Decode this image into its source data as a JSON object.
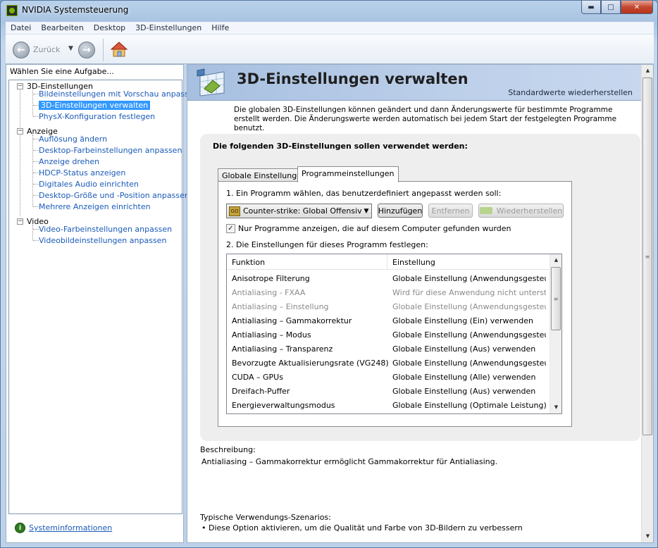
{
  "window": {
    "title": "NVIDIA Systemsteuerung",
    "buttons": {
      "minimize": "▬",
      "maximize": "□",
      "close": "✕"
    }
  },
  "menu": [
    "Datei",
    "Bearbeiten",
    "Desktop",
    "3D-Einstellungen",
    "Hilfe"
  ],
  "toolbar": {
    "back_label": "Zurück"
  },
  "left": {
    "header": "Wählen Sie eine Aufgabe...",
    "groups": [
      {
        "label": "3D-Einstellungen",
        "items": [
          "Bildeinstellungen mit Vorschau anpassen",
          "3D-Einstellungen verwalten",
          "PhysX-Konfiguration festlegen"
        ]
      },
      {
        "label": "Anzeige",
        "items": [
          "Auflösung ändern",
          "Desktop-Farbeinstellungen anpassen",
          "Anzeige drehen",
          "HDCP-Status anzeigen",
          "Digitales Audio einrichten",
          "Desktop-Größe und -Position anpassen",
          "Mehrere Anzeigen einrichten"
        ]
      },
      {
        "label": "Video",
        "items": [
          "Video-Farbeinstellungen anpassen",
          "Videobildeinstellungen anpassen"
        ]
      }
    ],
    "selected": "3D-Einstellungen verwalten",
    "sysinfo": "Systeminformationen"
  },
  "main": {
    "title": "3D-Einstellungen verwalten",
    "restore_defaults": "Standardwerte wiederherstellen",
    "intro": "Die globalen 3D-Einstellungen können geändert und dann Änderungswerte für bestimmte Programme erstellt werden. Die Änderungswerte werden automatisch bei jedem Start der festgelegten Programme benutzt.",
    "panel_heading": "Die folgenden 3D-Einstellungen sollen verwendet werden:",
    "tabs": [
      "Globale Einstellungen",
      "Programmeinstellungen"
    ],
    "active_tab": "Programmeinstellungen",
    "step1": "1. Ein Programm wählen, das benutzerdefiniert angepasst werden soll:",
    "program_selected": "Counter-strike: Global Offensiv...",
    "buttons": {
      "add": "Hinzufügen",
      "remove": "Entfernen",
      "restore": "Wiederherstellen"
    },
    "checkbox_label": "Nur Programme anzeigen, die auf diesem Computer gefunden wurden",
    "checkbox_checked": true,
    "step2": "2. Die Einstellungen für dieses Programm festlegen:",
    "grid_headers": [
      "Funktion",
      "Einstellung"
    ],
    "grid_rows": [
      {
        "function": "Anisotrope Filterung",
        "setting": "Globale Einstellung (Anwendungsgesteuer...",
        "disabled": false
      },
      {
        "function": "Antialiasing - FXAA",
        "setting": "Wird für diese Anwendung nicht unterstützt",
        "disabled": true
      },
      {
        "function": "Antialiasing – Einstellung",
        "setting": "Globale Einstellung (Anwendungsgesteuer...",
        "disabled": true
      },
      {
        "function": "Antialiasing – Gammakorrektur",
        "setting": "Globale Einstellung (Ein) verwenden",
        "disabled": false
      },
      {
        "function": "Antialiasing – Modus",
        "setting": "Globale Einstellung (Anwendungsgesteuer...",
        "disabled": false
      },
      {
        "function": "Antialiasing – Transparenz",
        "setting": "Globale Einstellung (Aus) verwenden",
        "disabled": false
      },
      {
        "function": "Bevorzugte Aktualisierungsrate (VG248)",
        "setting": "Globale Einstellung (Anwendungsgesteuer...",
        "disabled": false
      },
      {
        "function": "CUDA – GPUs",
        "setting": "Globale Einstellung (Alle) verwenden",
        "disabled": false
      },
      {
        "function": "Dreifach-Puffer",
        "setting": "Globale Einstellung (Aus) verwenden",
        "disabled": false
      },
      {
        "function": "Energieverwaltungsmodus",
        "setting": "Globale Einstellung (Optimale Leistung) ver...",
        "disabled": false
      }
    ],
    "description_label": "Beschreibung:",
    "description_text": "Antialiasing – Gammakorrektur ermöglicht Gammakorrektur für Antialiasing.",
    "scenarios_label": "Typische Verwendungs-Szenarios:",
    "scenarios_text": "• Diese Option aktivieren, um die Qualität und Farbe von 3D-Bildern zu verbessern"
  },
  "colors": {
    "link": "#1a5ab8",
    "selection": "#3399ff",
    "banner": "#bdd0ea",
    "nvidia_green": "#76b900"
  }
}
